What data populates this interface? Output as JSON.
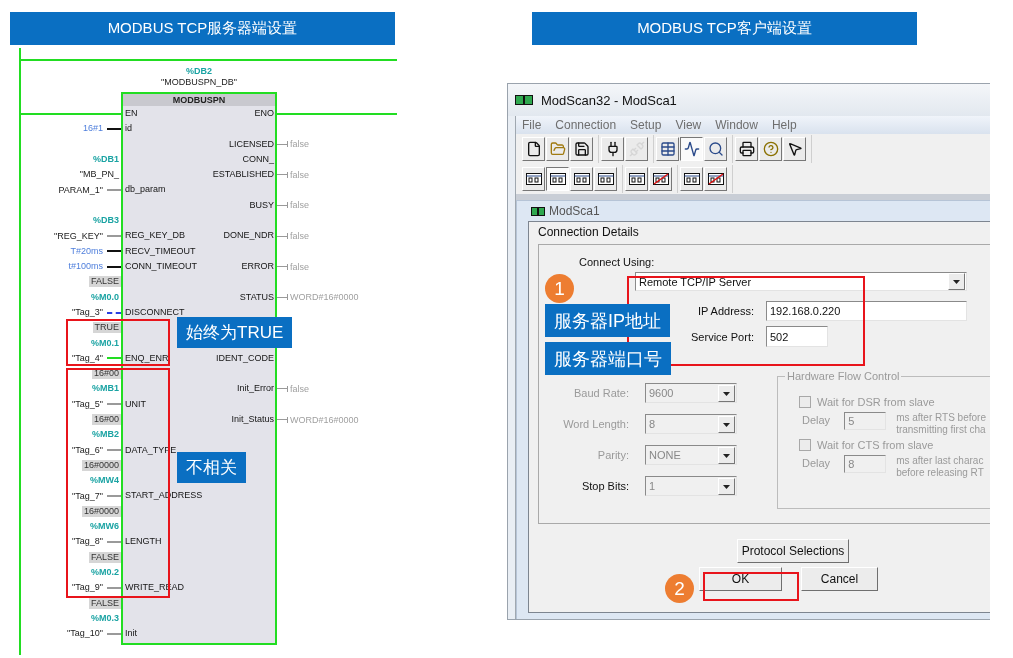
{
  "server": {
    "heading": "MODBUS TCP服务器端设置",
    "instance": {
      "address": "%DB2",
      "name": "\"MODBUSPN_DB\""
    },
    "block": {
      "title": "MODBUSPN",
      "inputs": [
        {
          "name": "EN",
          "kind": "power"
        },
        {
          "name": "id",
          "kind": "solid",
          "operand": [
            {
              "kind": "constant",
              "text": "16#1"
            }
          ]
        },
        {
          "name": "db_param",
          "kind": "gray",
          "operand": [
            {
              "kind": "address",
              "text": "%DB1"
            },
            {
              "kind": "tag",
              "text": "\"MB_PN_"
            },
            {
              "kind": "tag",
              "text": "PARAM_1\""
            }
          ]
        },
        {
          "name": "REG_KEY_DB",
          "kind": "gray",
          "operand": [
            {
              "kind": "address",
              "text": "%DB3"
            },
            {
              "kind": "tag",
              "text": "\"REG_KEY\""
            }
          ]
        },
        {
          "name": "RECV_TIMEOUT",
          "kind": "solid",
          "operand": [
            {
              "kind": "constant",
              "text": "T#20ms"
            }
          ]
        },
        {
          "name": "CONN_TIMEOUT",
          "kind": "solid",
          "operand": [
            {
              "kind": "constant",
              "text": "t#100ms"
            }
          ]
        },
        {
          "name": "DISCONNECT",
          "kind": "dashed",
          "operand": [
            {
              "kind": "value",
              "text": "FALSE"
            },
            {
              "kind": "address",
              "text": "%M0.0"
            },
            {
              "kind": "tag",
              "text": "\"Tag_3\""
            }
          ]
        },
        {
          "name": "ENQ_ENR",
          "kind": "power",
          "operand": [
            {
              "kind": "value",
              "text": "TRUE"
            },
            {
              "kind": "address",
              "text": "%M0.1"
            },
            {
              "kind": "tag",
              "text": "\"Tag_4\""
            }
          ]
        },
        {
          "name": "UNIT",
          "kind": "gray",
          "operand": [
            {
              "kind": "value",
              "text": "16#00"
            },
            {
              "kind": "address",
              "text": "%MB1"
            },
            {
              "kind": "tag",
              "text": "\"Tag_5\""
            }
          ]
        },
        {
          "name": "DATA_TYPE",
          "kind": "gray",
          "operand": [
            {
              "kind": "value",
              "text": "16#00"
            },
            {
              "kind": "address",
              "text": "%MB2"
            },
            {
              "kind": "tag",
              "text": "\"Tag_6\""
            }
          ]
        },
        {
          "name": "START_ADDRESS",
          "kind": "gray",
          "operand": [
            {
              "kind": "value",
              "text": "16#0000"
            },
            {
              "kind": "address",
              "text": "%MW4"
            },
            {
              "kind": "tag",
              "text": "\"Tag_7\""
            }
          ]
        },
        {
          "name": "LENGTH",
          "kind": "gray",
          "operand": [
            {
              "kind": "value",
              "text": "16#0000"
            },
            {
              "kind": "address",
              "text": "%MW6"
            },
            {
              "kind": "tag",
              "text": "\"Tag_8\""
            }
          ]
        },
        {
          "name": "WRITE_READ",
          "kind": "gray",
          "operand": [
            {
              "kind": "value",
              "text": "FALSE"
            },
            {
              "kind": "address",
              "text": "%M0.2"
            },
            {
              "kind": "tag",
              "text": "\"Tag_9\""
            }
          ]
        },
        {
          "name": "Init",
          "kind": "gray",
          "operand": [
            {
              "kind": "value",
              "text": "FALSE"
            },
            {
              "kind": "address",
              "text": "%M0.3"
            },
            {
              "kind": "tag",
              "text": "\"Tag_10\""
            }
          ]
        }
      ],
      "outputs": [
        {
          "name": "ENO",
          "kind": "power"
        },
        {
          "name": "LICENSED",
          "kind": "gray",
          "value": "false"
        },
        {
          "name": "CONN_\nESTABLISHED",
          "kind": "gray",
          "value": "false"
        },
        {
          "name": "BUSY",
          "kind": "gray",
          "value": "false"
        },
        {
          "name": "DONE_NDR",
          "kind": "gray",
          "value": "false"
        },
        {
          "name": "ERROR",
          "kind": "gray",
          "value": "false"
        },
        {
          "name": "STATUS",
          "kind": "gray",
          "value": "WORD#16#0000"
        },
        {
          "name": "IDENT_CODE",
          "kind": "none"
        },
        {
          "name": "Init_Error",
          "kind": "gray",
          "value": "false"
        },
        {
          "name": "Init_Status",
          "kind": "gray",
          "value": "WORD#16#0000"
        }
      ]
    },
    "notes": [
      "始终为TRUE",
      "不相关"
    ]
  },
  "client": {
    "heading": "MODBUS TCP客户端设置",
    "window": {
      "title": "ModScan32 - ModSca1",
      "menu": [
        "File",
        "Connection",
        "Setup",
        "View",
        "Window",
        "Help"
      ],
      "toolbars": [
        {
          "groups": [
            [
              {
                "kind": "new",
                "pressed": false,
                "disabled": false
              },
              {
                "kind": "open",
                "pressed": false,
                "disabled": false
              },
              {
                "kind": "save",
                "pressed": false,
                "disabled": false
              }
            ],
            [
              {
                "kind": "connect",
                "pressed": false,
                "disabled": false
              },
              {
                "kind": "disconnect",
                "pressed": false,
                "disabled": true
              }
            ],
            [
              {
                "kind": "tables",
                "pressed": false,
                "disabled": false
              },
              {
                "kind": "chart",
                "pressed": true,
                "disabled": false
              },
              {
                "kind": "inspect",
                "pressed": false,
                "disabled": false
              }
            ],
            [
              {
                "kind": "print",
                "pressed": false,
                "disabled": false
              },
              {
                "kind": "help",
                "pressed": false,
                "disabled": false
              },
              {
                "kind": "context-help",
                "pressed": false,
                "disabled": false
              }
            ]
          ]
        },
        {
          "groups": [
            [
              {
                "kind": "format",
                "pressed": false,
                "disabled": false
              },
              {
                "kind": "format",
                "pressed": true,
                "disabled": false
              },
              {
                "kind": "format",
                "pressed": false,
                "disabled": false
              },
              {
                "kind": "format",
                "pressed": false,
                "disabled": false
              }
            ],
            [
              {
                "kind": "format",
                "pressed": false,
                "disabled": false
              },
              {
                "kind": "format-off",
                "pressed": false,
                "disabled": false
              }
            ],
            [
              {
                "kind": "format",
                "pressed": false,
                "disabled": false
              },
              {
                "kind": "format-off",
                "pressed": false,
                "disabled": false
              }
            ]
          ]
        }
      ],
      "child_title": "ModSca1",
      "dialog": {
        "title": "Connection Details",
        "connect_label": "Connect Using:",
        "connect_value": "Remote TCP/IP Server",
        "ip_label": "IP Address:",
        "ip_value": "192.168.0.220",
        "port_label": "Service Port:",
        "port_value": "502",
        "serial": [
          {
            "label": "Baud Rate:",
            "value": "9600",
            "label_disabled": true,
            "disabled": true
          },
          {
            "label": "Word Length:",
            "value": "8",
            "label_disabled": true,
            "disabled": true
          },
          {
            "label": "Parity:",
            "value": "NONE",
            "label_disabled": true,
            "disabled": true
          },
          {
            "label": "Stop Bits:",
            "value": "1",
            "label_disabled": false,
            "disabled": true
          }
        ],
        "flow": {
          "title": "Hardware Flow Control",
          "options": [
            {
              "label": "Wait for DSR from slave",
              "checked": false,
              "disabled": true,
              "delay_label": "Delay",
              "delay": "5",
              "note": [
                "ms after RTS before",
                "transmitting first cha"
              ]
            },
            {
              "label": "Wait for CTS from slave",
              "checked": false,
              "disabled": true,
              "delay_label": "Delay",
              "delay": "8",
              "note": [
                "ms after last charac",
                "before releasing RT"
              ]
            }
          ]
        },
        "buttons": [
          "Protocol Selections",
          "OK",
          "Cancel"
        ]
      }
    },
    "steps": [
      "1",
      "2"
    ],
    "callouts": [
      "服务器IP地址",
      "服务器端口号"
    ]
  }
}
